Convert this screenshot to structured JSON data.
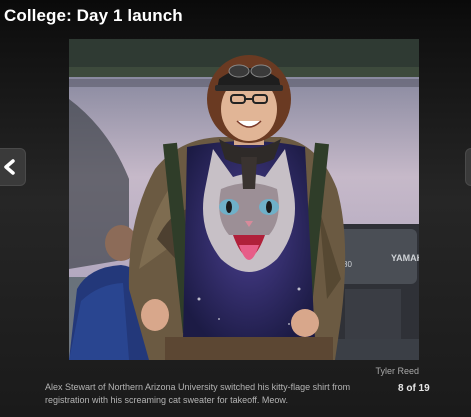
{
  "gallery": {
    "title": "College: Day 1 launch",
    "prev_icon": "chevron-left-icon",
    "next_icon": "chevron-right-icon",
    "photo": {
      "credit": "Tyler Reed",
      "caption": "Alex Stewart of Northern Arizona University switched his kitty-flage shirt from registration with his screaming cat sweater for takeoff. Meow.",
      "engine_brand": "YAMAHA",
      "engine_label": "80"
    },
    "counter": "8 of 19"
  }
}
